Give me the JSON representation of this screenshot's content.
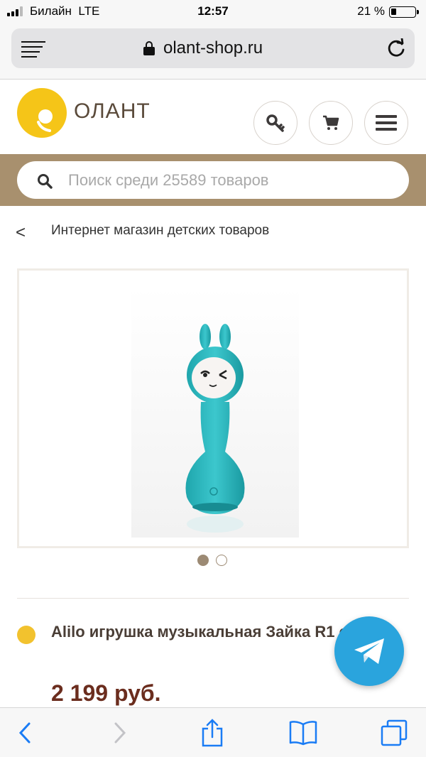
{
  "status_bar": {
    "carrier": "Билайн",
    "network": "LTE",
    "time": "12:57",
    "battery_percent": "21 %",
    "signal_bars_on": 3,
    "battery_level": 0.21
  },
  "browser": {
    "url": "olant-shop.ru",
    "icons": [
      "reader-icon",
      "lock-icon",
      "reload-icon"
    ]
  },
  "header": {
    "logo_text": "ОЛАНТ",
    "brand_color": "#f5c518",
    "buttons": [
      "key-icon",
      "cart-icon",
      "menu-icon"
    ]
  },
  "search": {
    "placeholder": "Поиск среди 25589 товаров",
    "band_color": "#a8906e"
  },
  "breadcrumb": {
    "back_glyph": "<",
    "label": "Интернет магазин детских товаров"
  },
  "gallery": {
    "slides": 2,
    "active_index": 0
  },
  "product": {
    "title": "Alilo игрушка музыкальная Зайка R1 синий",
    "price": "2 199 руб.",
    "availability_color": "#f2c22e"
  },
  "fab": {
    "icon": "telegram-icon",
    "color": "#2aa4dd"
  },
  "toolbar": {
    "icons": [
      "back-icon",
      "forward-icon",
      "share-icon",
      "bookmarks-icon",
      "tabs-icon"
    ]
  }
}
